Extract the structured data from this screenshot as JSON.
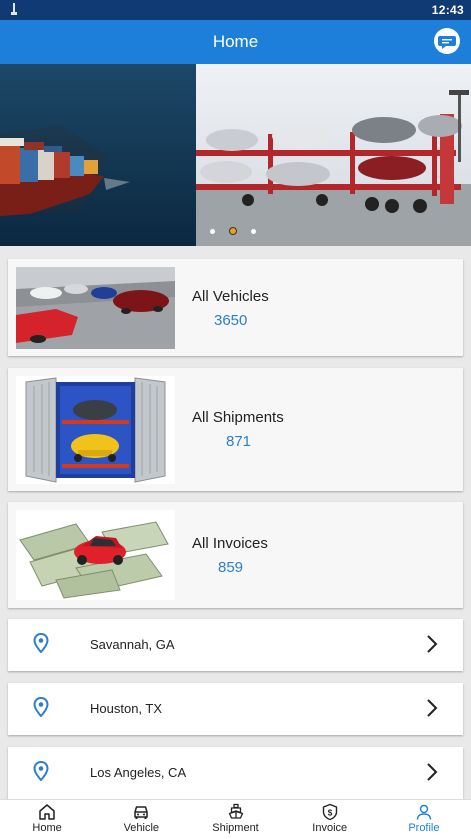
{
  "status_bar": {
    "time": "12:43"
  },
  "app_bar": {
    "title": "Home"
  },
  "carousel": {
    "slides": [
      "Cargo ship",
      "Car carrier truck",
      "Slide 3"
    ],
    "active_index": 1
  },
  "summary_cards": [
    {
      "label": "All Vehicles",
      "count": "3650"
    },
    {
      "label": "All Shipments",
      "count": "871"
    },
    {
      "label": "All Invoices",
      "count": "859"
    }
  ],
  "locations": [
    {
      "name": "Savannah, GA"
    },
    {
      "name": "Houston, TX"
    },
    {
      "name": "Los Angeles, CA"
    }
  ],
  "bottom_nav": [
    {
      "label": "Home",
      "icon": "home-icon"
    },
    {
      "label": "Vehicle",
      "icon": "car-icon"
    },
    {
      "label": "Shipment",
      "icon": "ship-icon"
    },
    {
      "label": "Invoice",
      "icon": "invoice-icon"
    },
    {
      "label": "Profile",
      "icon": "profile-icon",
      "active": true
    }
  ],
  "colors": {
    "primary": "#1d7fd9",
    "status_bar": "#0f3a73",
    "count_text": "#2c7fc8",
    "active_dot": "#e8a317"
  }
}
